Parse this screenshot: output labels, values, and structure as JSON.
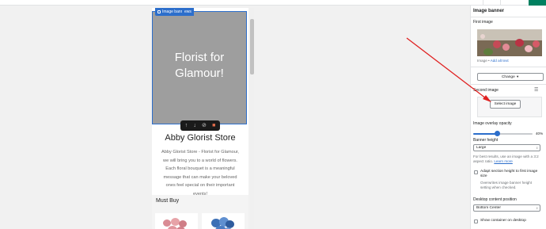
{
  "preview": {
    "banner_tag": "Image banner",
    "banner_tag2": "ews",
    "banner_title_line1": "Florist for",
    "banner_title_line2": "Glamour!",
    "toolbar_icons": [
      "move-up-icon",
      "move-down-icon",
      "hide-icon",
      "delete-icon"
    ],
    "store_name": "Abby Glorist Store",
    "store_description": "Abby Glorist Store - Florist for Glamour, we will bring you to a world of flowers. Each floral bouquet is a meaningful message that can make your beloved ones feel special on their important events!",
    "section_title": "Must Buy"
  },
  "panel": {
    "title": "Image banner",
    "first_image_label": "First image",
    "image_alt_prefix": "Image • ",
    "image_alt_link": "Add alt text",
    "change_button": "Change",
    "second_image_label": "Second image",
    "select_image_button": "Select image",
    "overlay_label": "Image overlay opacity",
    "overlay_value": "40%",
    "overlay_fraction": 0.4,
    "banner_height_label": "Banner height",
    "banner_height_value": "Large",
    "banner_help_text": "For best results, use an image with a 3:2 aspect ratio. ",
    "banner_help_link": "Learn more",
    "adapt_label": "Adapt section height to first image size",
    "adapt_help": "Overwrites image banner height setting when checked.",
    "desktop_position_label": "Desktop content position",
    "desktop_position_value": "Bottom Center",
    "show_container_label": "Show container on desktop"
  },
  "colors": {
    "accent": "#2c6ecb",
    "save_button": "#008060",
    "banner_overlay": "#9e9e9e",
    "annotation_arrow": "#e02020"
  }
}
